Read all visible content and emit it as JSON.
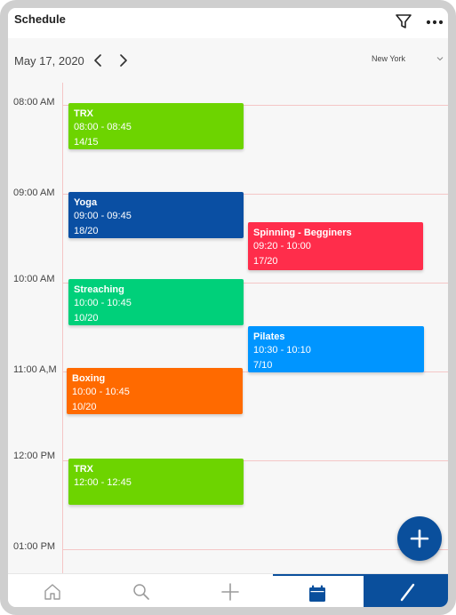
{
  "header": {
    "title": "Schedule",
    "icons": [
      "filter-icon",
      "more-icon"
    ]
  },
  "date_bar": {
    "date": "May 17, 2020",
    "timezone": "New York"
  },
  "time_slots": [
    "08:00 AM",
    "09:00 AM",
    "10:00 AM",
    "11:00 A,M",
    "12:00 PM",
    "01:00 PM"
  ],
  "events": [
    {
      "title": "TRX",
      "time": "08:00 - 08:45",
      "capacity": "14/15",
      "color": "#6dd400"
    },
    {
      "title": "Yoga",
      "time": "09:00 - 09:45",
      "capacity": "18/20",
      "color": "#0a4fa3"
    },
    {
      "title": "Spinning - Begginers",
      "time": "09:20 - 10:00",
      "capacity": "17/20",
      "color": "#ff2d4b"
    },
    {
      "title": "Streaching",
      "time": "10:00 - 10:45",
      "capacity": "10/20",
      "color": "#00d07a"
    },
    {
      "title": "Pilates",
      "time": "10:30 - 10:10",
      "capacity": "7/10",
      "color": "#0095ff"
    },
    {
      "title": "Boxing",
      "time": "10:00 - 10:45",
      "capacity": "10/20",
      "color": "#ff6a00"
    },
    {
      "title": "TRX",
      "time": "12:00 - 12:45",
      "capacity": "",
      "color": "#6dd400"
    }
  ],
  "fab": {
    "icon": "plus-icon"
  },
  "bottom_nav": {
    "items": [
      "home-icon",
      "search-icon",
      "plus-icon",
      "calendar-icon",
      "edit-icon"
    ],
    "active": "calendar-icon"
  },
  "colors": {
    "accent": "#0a4f9c",
    "grid_line": "#f4c6c6"
  }
}
